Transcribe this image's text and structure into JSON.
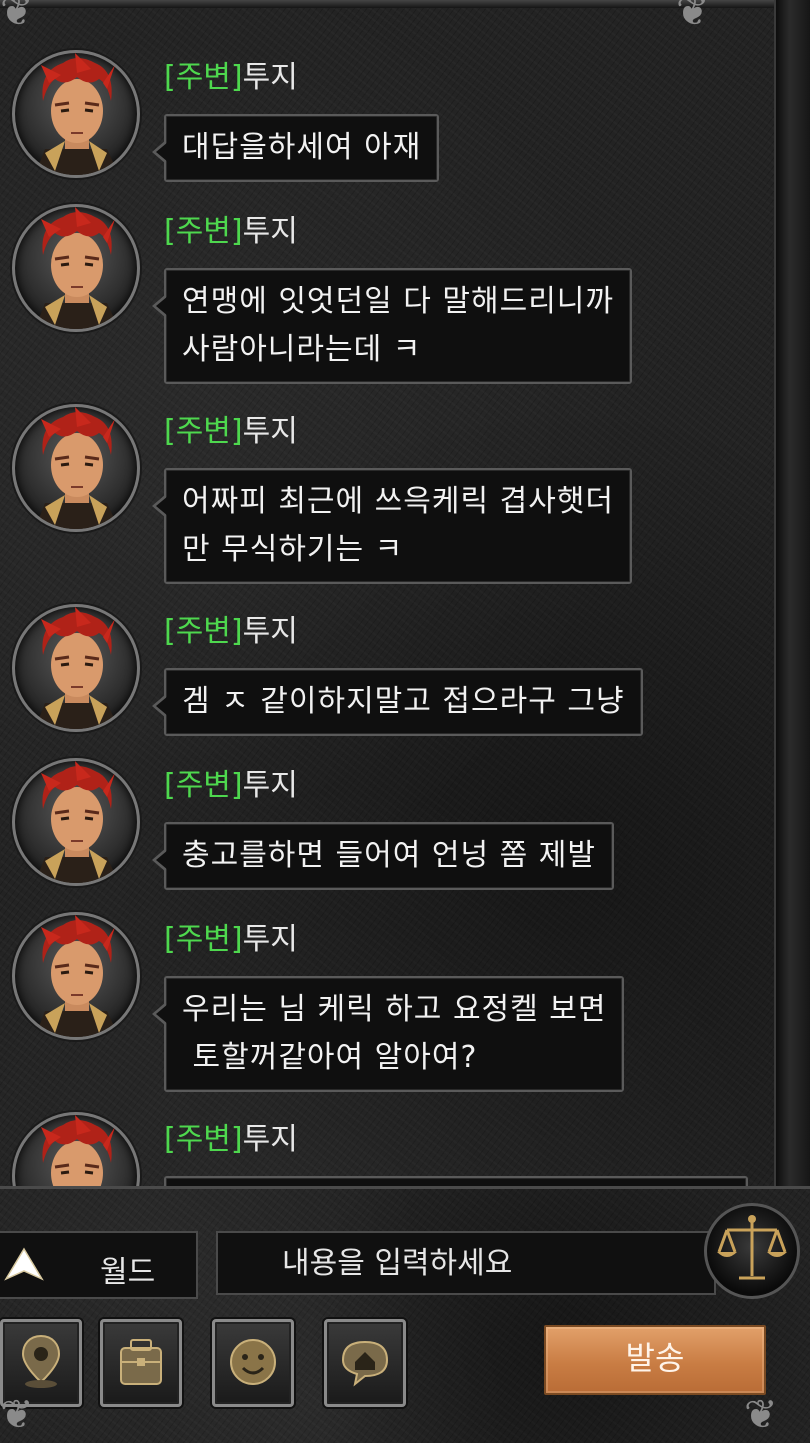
{
  "messages": [
    {
      "channel": "[주변]",
      "sender": "투지",
      "text": "대답을하세여 아재"
    },
    {
      "channel": "[주변]",
      "sender": "투지",
      "text": "연맹에 잇엇던일 다 말해드리니까\n사람아니라는데 ㅋ"
    },
    {
      "channel": "[주변]",
      "sender": "투지",
      "text": "어짜피 최근에 쓰윽케릭 겹사햇더\n만 무식하기는 ㅋ"
    },
    {
      "channel": "[주변]",
      "sender": "투지",
      "text": "겜 ㅈ 같이하지말고 접으라구 그냥"
    },
    {
      "channel": "[주변]",
      "sender": "투지",
      "text": "충고를하면 들어여 언넝 쫌 제발"
    },
    {
      "channel": "[주변]",
      "sender": "투지",
      "text": "우리는 님 케릭 하고 요정켈 보면\n 토할꺼같아여 알아여?"
    },
    {
      "channel": "[주변]",
      "sender": "투지",
      "text": ""
    }
  ],
  "input": {
    "channel_label": "월드",
    "placeholder": "내용을 입력하세요"
  },
  "toolbar": {
    "icons": [
      "location-pin-icon",
      "bag-icon",
      "emoji-icon",
      "home-bubble-icon",
      "scale-icon"
    ],
    "send_label": "발송"
  },
  "colors": {
    "channel_tag": "#4ed84e",
    "send_button": "#c97d44"
  }
}
